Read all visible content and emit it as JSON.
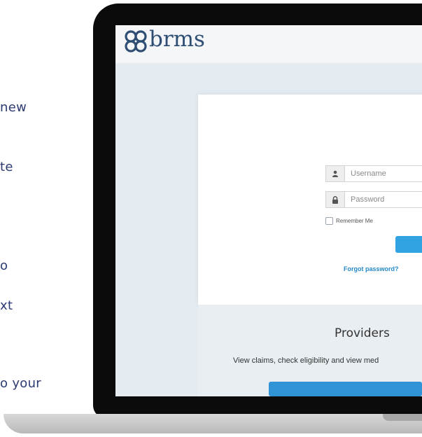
{
  "left_text": [
    "new",
    "te",
    "o",
    "xt",
    "o your"
  ],
  "app": {
    "logo_text": "brms",
    "login": {
      "username_placeholder": "Username",
      "password_placeholder": "Password",
      "remember_label": "Remember Me",
      "remember_checked": false,
      "forgot_link": "Forgot password?"
    },
    "providers": {
      "title": "Providers",
      "description": "View claims, check eligibility and view med"
    }
  },
  "colors": {
    "brand": "#2e4e74",
    "accent": "#32a3e2",
    "link": "#2589c8",
    "left_text": "#2c3a72"
  },
  "icons": {
    "username": "user-icon",
    "password": "lock-icon",
    "logo": "clover-logo-icon"
  }
}
